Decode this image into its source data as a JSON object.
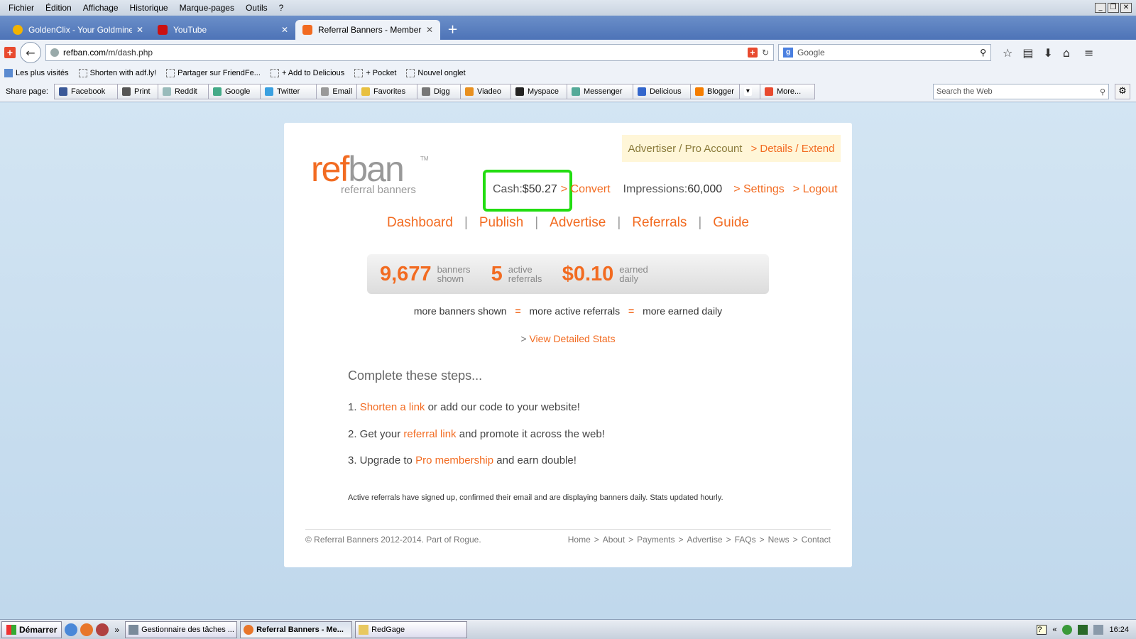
{
  "browser": {
    "menu": [
      "Fichier",
      "Édition",
      "Affichage",
      "Historique",
      "Marque-pages",
      "Outils",
      "?"
    ],
    "tabs": [
      {
        "title": "GoldenClix - Your Goldmine!",
        "color": "#f2b300"
      },
      {
        "title": "YouTube",
        "color": "#cc1111"
      },
      {
        "title": "Referral Banners - Member Ar...",
        "color": "#f26b21"
      }
    ],
    "url_host": "refban.com",
    "url_path": "/m/dash.php",
    "search_placeholder": "Google",
    "bookmarks": [
      "Les plus visités",
      "Shorten with adf.ly!",
      "Partager sur FriendFe...",
      "+ Add to Delicious",
      "+ Pocket",
      "Nouvel onglet"
    ],
    "share_label": "Share page:",
    "share_buttons": [
      {
        "label": "Facebook",
        "color": "#3b5998"
      },
      {
        "label": "Print",
        "color": "#555555"
      },
      {
        "label": "Reddit",
        "color": "#9bb"
      },
      {
        "label": "Google",
        "color": "#4a8"
      },
      {
        "label": "Twitter",
        "color": "#3aa0e0"
      },
      {
        "label": "Email",
        "color": "#999"
      },
      {
        "label": "Favorites",
        "color": "#e8c040"
      },
      {
        "label": "Digg",
        "color": "#777"
      },
      {
        "label": "Viadeo",
        "color": "#e89020"
      },
      {
        "label": "Myspace",
        "color": "#222"
      },
      {
        "label": "Messenger",
        "color": "#5a9"
      },
      {
        "label": "Delicious",
        "color": "#3366cc"
      },
      {
        "label": "Blogger",
        "color": "#f57d00"
      },
      {
        "label": "",
        "color": "#fff"
      },
      {
        "label": "More...",
        "color": "#e84a2f"
      }
    ],
    "web_search_placeholder": "Search the Web"
  },
  "site": {
    "logo_ref": "ref",
    "logo_ban": "ban",
    "logo_tm": "TM",
    "logo_sub": "referral banners",
    "pro_account": "Advertiser / Pro Account",
    "details_extend": "> Details / Extend",
    "cash_label": "Cash: ",
    "cash_value": "$50.27",
    "convert": "> Convert",
    "impressions_label": "Impressions: ",
    "impressions_value": "60,000",
    "settings": "> Settings",
    "logout": "> Logout",
    "nav": [
      "Dashboard",
      "Publish",
      "Advertise",
      "Referrals",
      "Guide"
    ],
    "stats": [
      {
        "value": "9,677",
        "cap1": "banners",
        "cap2": "shown"
      },
      {
        "value": "5",
        "cap1": "active",
        "cap2": "referrals"
      },
      {
        "value": "$0.10",
        "cap1": "earned",
        "cap2": "daily"
      }
    ],
    "equation": [
      "more banners shown",
      "=",
      "more active referrals",
      "=",
      "more earned daily"
    ],
    "detailed_prefix": "> ",
    "detailed_link": "View Detailed Stats",
    "steps_title": "Complete these steps...",
    "steps": [
      {
        "pre": "1. ",
        "link": "Shorten a link",
        "post": " or add our code to your website!"
      },
      {
        "pre": "2. Get your ",
        "link": "referral link",
        "post": " and promote it across the web!"
      },
      {
        "pre": "3. Upgrade to ",
        "link": "Pro membership",
        "post": " and earn double!"
      }
    ],
    "note": "Active referrals have signed up, confirmed their email and are displaying banners daily. Stats updated hourly.",
    "copyright": "© Referral Banners 2012-2014. Part of Rogue.",
    "footer_links": [
      "Home",
      "About",
      "Payments",
      "Advertise",
      "FAQs",
      "News",
      "Contact"
    ]
  },
  "taskbar": {
    "start": "Démarrer",
    "more": "»",
    "tasks": [
      "Gestionnaire des tâches ...",
      "Referral Banners - Me...",
      "RedGage"
    ],
    "clock": "16:24",
    "tray_chevron": "«"
  }
}
